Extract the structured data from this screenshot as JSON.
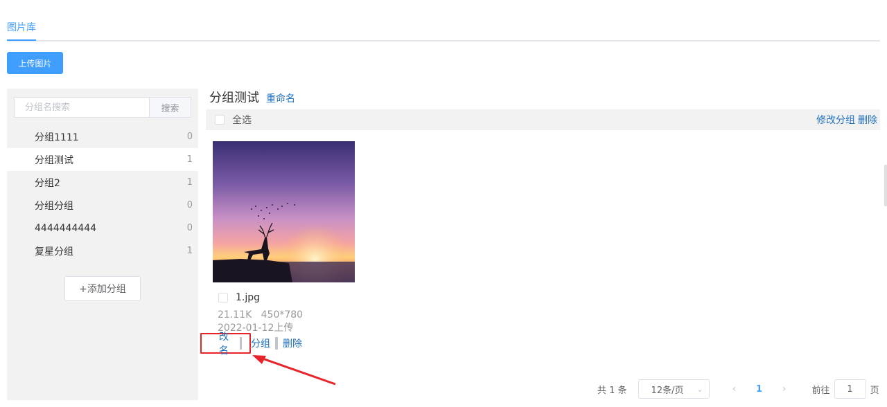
{
  "tabs": {
    "active": "图片库"
  },
  "upload_button": "上传图片",
  "sidebar": {
    "search": {
      "placeholder": "分组名搜索",
      "button": "搜索"
    },
    "groups": [
      {
        "name": "分组1111",
        "count": "0",
        "active": false
      },
      {
        "name": "分组测试",
        "count": "1",
        "active": true
      },
      {
        "name": "分组2",
        "count": "1",
        "active": false
      },
      {
        "name": "分组分组",
        "count": "0",
        "active": false
      },
      {
        "name": "4444444444",
        "count": "0",
        "active": false
      },
      {
        "name": "复星分组",
        "count": "1",
        "active": false
      }
    ],
    "add_group": "+添加分组"
  },
  "content": {
    "title": "分组测试",
    "rename": "重命名",
    "select_all": "全选",
    "edit_group": "修改分组",
    "delete": "删除"
  },
  "image": {
    "filename": "1.jpg",
    "size": "21.11K",
    "dimensions": "450*780",
    "upload_date": "2022-01-12上传",
    "actions": {
      "rename": "改名",
      "group": "分组",
      "delete": "删除"
    }
  },
  "pagination": {
    "total": "共 1 条",
    "page_size": "12条/页",
    "current_page": "1",
    "goto_label": "前往",
    "goto_value": "1",
    "goto_suffix": "页"
  },
  "colors": {
    "primary": "#409eff",
    "link": "#1e6fbf",
    "highlight": "#e8242b"
  }
}
